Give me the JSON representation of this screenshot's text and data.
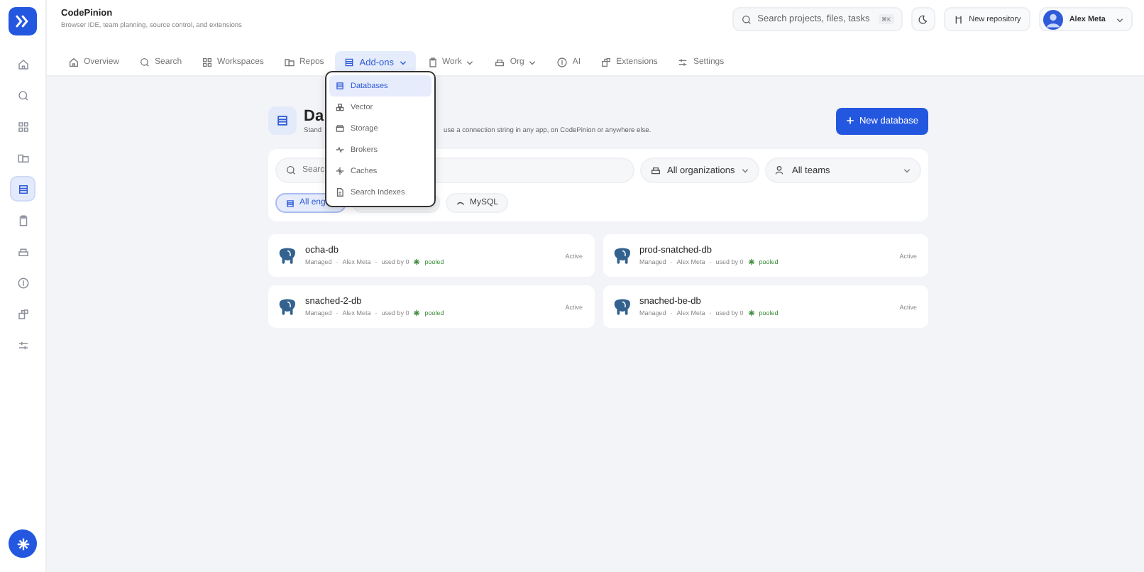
{
  "app": {
    "name": "CodePinion",
    "tagline": "Browser IDE, team planning, source control, and extensions"
  },
  "sidebar": {
    "items": [
      {
        "kind": "home",
        "selected": false
      },
      {
        "kind": "search",
        "selected": false
      },
      {
        "kind": "grid",
        "selected": false
      },
      {
        "kind": "repo",
        "selected": false
      },
      {
        "kind": "db",
        "selected": true
      },
      {
        "kind": "clip",
        "selected": false
      },
      {
        "kind": "org",
        "selected": false
      },
      {
        "kind": "ai",
        "selected": false
      },
      {
        "kind": "ext",
        "selected": false
      },
      {
        "kind": "settings",
        "selected": false
      }
    ]
  },
  "search": {
    "placeholder": "Search projects, files, tasks",
    "shortcut": "⌘K"
  },
  "new_repository": "New repository",
  "user": {
    "name": "Alex Meta"
  },
  "nav": [
    {
      "label": "Overview",
      "kind": "home",
      "selected": false,
      "menu": false
    },
    {
      "label": "Search",
      "kind": "search",
      "selected": false,
      "menu": false
    },
    {
      "label": "Workspaces",
      "kind": "grid",
      "selected": false,
      "menu": false
    },
    {
      "label": "Repos",
      "kind": "repo",
      "selected": false,
      "menu": false
    },
    {
      "label": "Add-ons",
      "kind": "db",
      "selected": true,
      "menu": true
    },
    {
      "label": "Work",
      "kind": "clip",
      "selected": false,
      "menu": true
    },
    {
      "label": "Org",
      "kind": "org",
      "selected": false,
      "menu": true
    },
    {
      "label": "AI",
      "kind": "ai",
      "selected": false,
      "menu": false
    },
    {
      "label": "Extensions",
      "kind": "ext",
      "selected": false,
      "menu": false
    },
    {
      "label": "Settings",
      "kind": "settings",
      "selected": false,
      "menu": false
    }
  ],
  "menu": [
    {
      "label": "Databases",
      "kind": "db",
      "selected": true
    },
    {
      "label": "Vector",
      "kind": "vector",
      "selected": false
    },
    {
      "label": "Storage",
      "kind": "storage",
      "selected": false
    },
    {
      "label": "Brokers",
      "kind": "broker",
      "selected": false
    },
    {
      "label": "Caches",
      "kind": "cache",
      "selected": false
    },
    {
      "label": "Search Indexes",
      "kind": "doc",
      "selected": false
    }
  ],
  "separator": "·",
  "page": {
    "title": "Da",
    "subtitle_start": "Stand",
    "subtitle_end": "use a connection string in any app, on CodePinion or anywhere else.",
    "new_button": "New database"
  },
  "filters": {
    "search_placeholder": "Searc",
    "organization": "All organizations",
    "team": "All teams"
  },
  "chips": [
    {
      "label": "All eng",
      "kind": "db",
      "selected": true
    },
    {
      "selected": false
    },
    {
      "label": "MySQL",
      "kind": "mysql",
      "selected": false
    }
  ],
  "databases": [
    {
      "name": "ocha-db",
      "mode": "Managed",
      "owner": "Alex Meta",
      "usage": "used by 0",
      "pool": "pooled",
      "status": "Active"
    },
    {
      "name": "prod-snatched-db",
      "mode": "Managed",
      "owner": "Alex Meta",
      "usage": "used by 0",
      "pool": "pooled",
      "status": "Active"
    },
    {
      "name": "snached-2-db",
      "mode": "Managed",
      "owner": "Alex Meta",
      "usage": "used by 0",
      "pool": "pooled",
      "status": "Active"
    },
    {
      "name": "snached-be-db",
      "mode": "Managed",
      "owner": "Alex Meta",
      "usage": "used by 0",
      "pool": "pooled",
      "status": "Active"
    }
  ]
}
